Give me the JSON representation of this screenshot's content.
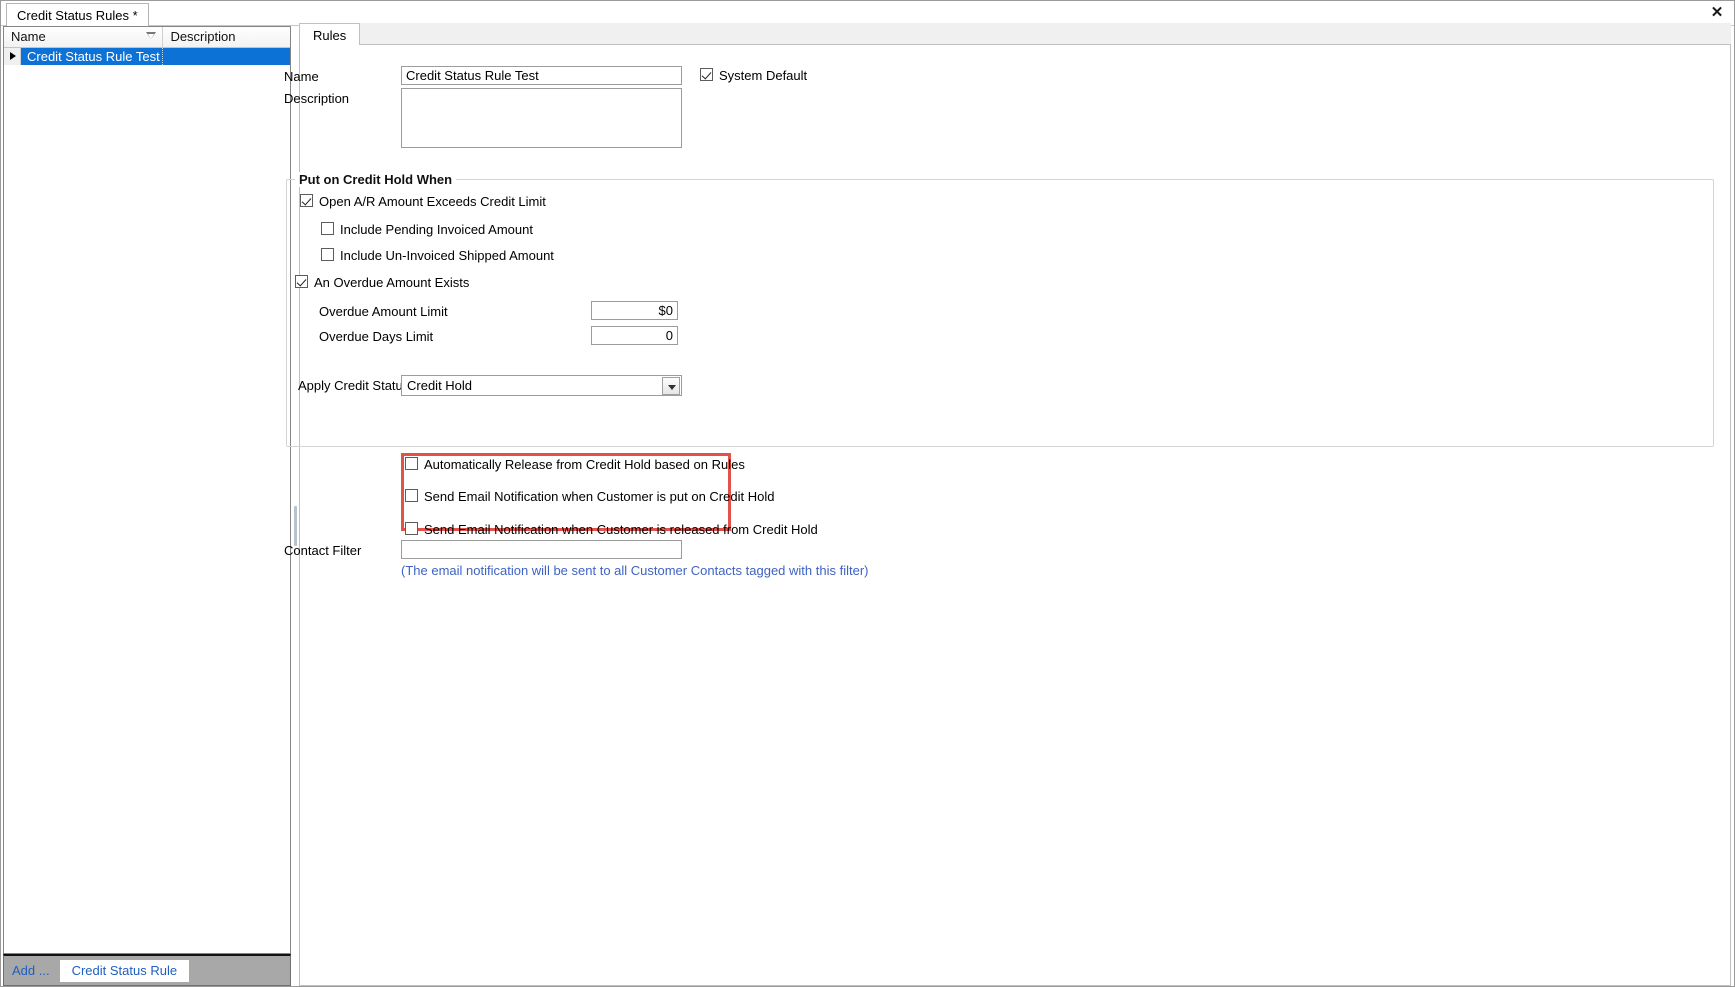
{
  "window": {
    "document_tab": "Credit Status Rules *",
    "close_label": "✕"
  },
  "left_panel": {
    "columns": {
      "name": "Name",
      "description": "Description"
    },
    "rows": [
      {
        "name": "Credit Status Rule Test",
        "description": ""
      }
    ],
    "footer": {
      "add_link": "Add ...",
      "add_button": "Credit Status Rule"
    }
  },
  "right_pane": {
    "tab": "Rules"
  },
  "form": {
    "name_label": "Name",
    "name_value": "Credit Status Rule Test",
    "description_label": "Description",
    "description_value": "",
    "system_default_label": "System Default",
    "system_default_checked": true,
    "group_title": "Put on Credit Hold When",
    "open_ar_label": "Open A/R Amount Exceeds Credit Limit",
    "open_ar_checked": true,
    "include_pending_label": "Include Pending Invoiced Amount",
    "include_pending_checked": false,
    "include_uninvoiced_label": "Include Un-Invoiced Shipped Amount",
    "include_uninvoiced_checked": false,
    "overdue_exists_label": "An Overdue Amount Exists",
    "overdue_exists_checked": true,
    "overdue_amount_label": "Overdue Amount Limit",
    "overdue_amount_value": "$0",
    "overdue_days_label": "Overdue Days Limit",
    "overdue_days_value": "0",
    "apply_status_label": "Apply Credit Status",
    "apply_status_value": "Credit Hold",
    "auto_release_label": "Automatically Release from Credit Hold based on Rules",
    "auto_release_checked": false,
    "email_put_label": "Send Email Notification when Customer is put on Credit Hold",
    "email_put_checked": false,
    "email_released_label": "Send Email Notification when Customer is released from Credit Hold",
    "email_released_checked": false,
    "contact_filter_label": "Contact Filter",
    "contact_filter_value": "",
    "contact_filter_hint": "(The email notification will be sent to all Customer Contacts tagged with this filter)"
  },
  "colors": {
    "selection": "#0d72d6",
    "highlight_border": "#e2514a",
    "hint_text": "#3f62c4",
    "link": "#1f5fbf"
  }
}
